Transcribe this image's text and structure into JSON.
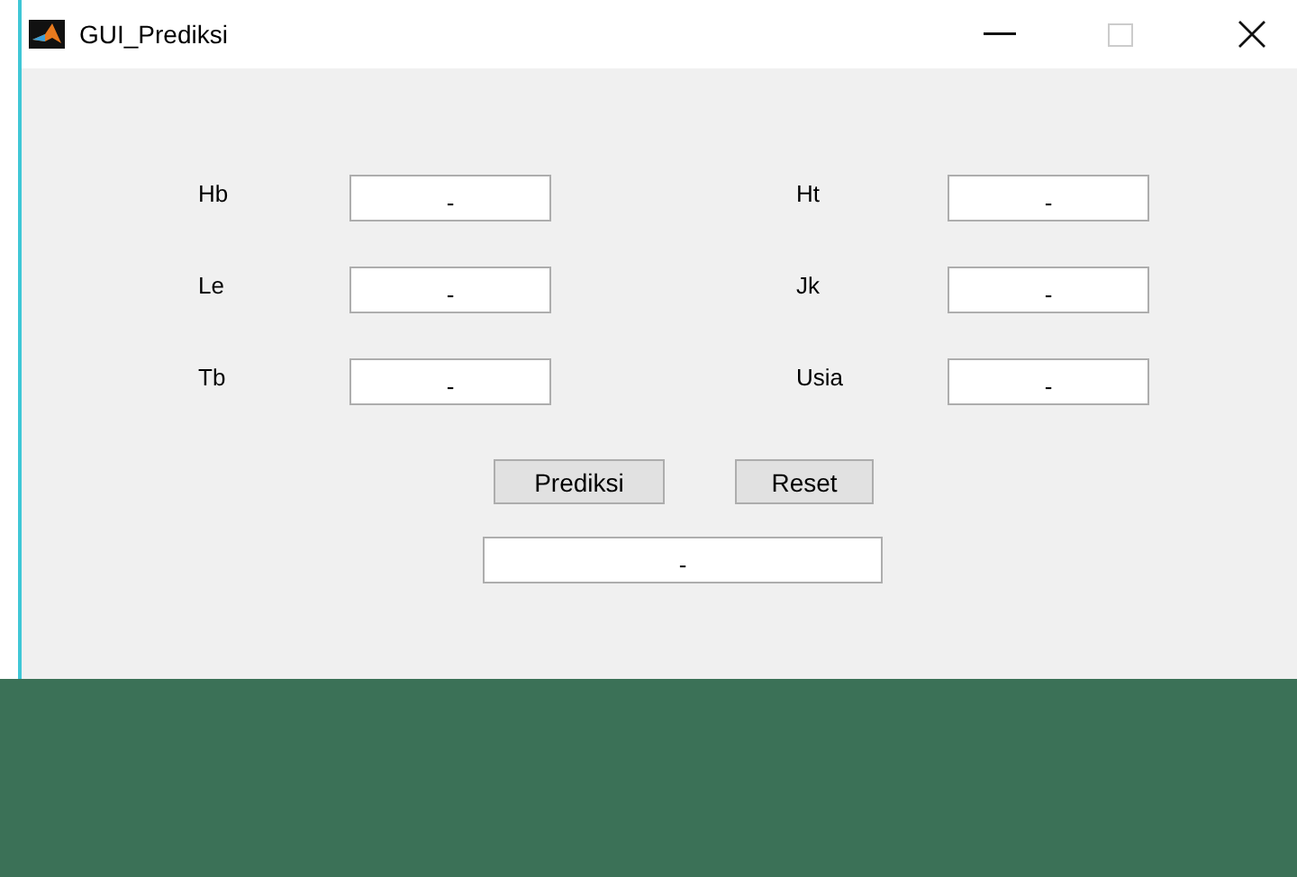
{
  "window": {
    "title": "GUI_Prediksi"
  },
  "fields": [
    {
      "label": "Hb",
      "value": "-"
    },
    {
      "label": "Ht",
      "value": "-"
    },
    {
      "label": "Le",
      "value": "-"
    },
    {
      "label": "Jk",
      "value": "-"
    },
    {
      "label": "Tb",
      "value": "-"
    },
    {
      "label": "Usia",
      "value": "-"
    }
  ],
  "buttons": [
    "Prediksi",
    "Reset"
  ],
  "result": {
    "value": "-"
  }
}
